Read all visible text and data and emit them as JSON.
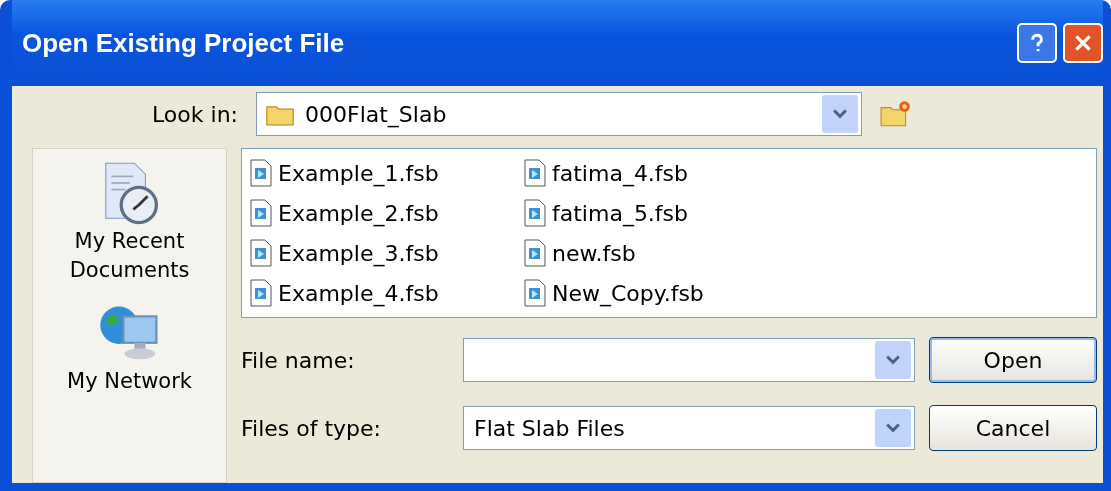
{
  "window": {
    "title": "Open Existing Project File"
  },
  "look_in": {
    "label": "Look in:",
    "value": "000Flat_Slab"
  },
  "places": [
    {
      "label": "My Recent Documents",
      "kind": "recent"
    },
    {
      "label": "My Network",
      "kind": "network"
    }
  ],
  "files": [
    {
      "name": "Example_1.fsb"
    },
    {
      "name": "Example_2.fsb"
    },
    {
      "name": "Example_3.fsb"
    },
    {
      "name": "Example_4.fsb"
    },
    {
      "name": "fatima_4.fsb"
    },
    {
      "name": "fatima_5.fsb"
    },
    {
      "name": "new.fsb"
    },
    {
      "name": "New_Copy.fsb"
    }
  ],
  "file_name": {
    "label": "File name:"
  },
  "file_type": {
    "label": "Files of type:",
    "value": "Flat Slab Files"
  },
  "buttons": [
    {
      "label": "Open",
      "kind": "default"
    },
    {
      "label": "Cancel",
      "kind": "normal"
    }
  ]
}
